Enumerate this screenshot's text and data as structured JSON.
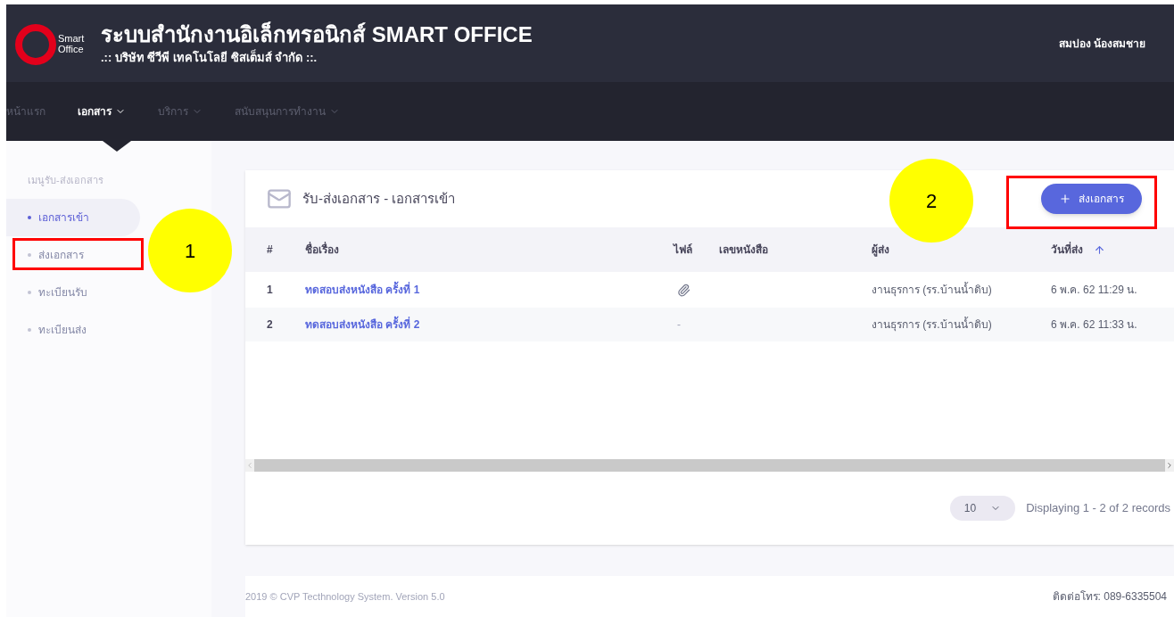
{
  "header": {
    "logo_text": [
      "Smart",
      "Office"
    ],
    "title": "ระบบสำนักงานอิเล็กทรอนิกส์ SMART OFFICE",
    "subtitle": ".:: บริษัท ซีวีพี เทคโนโลยี ซิสเต็มส์ จำกัด ::.",
    "user": "สมปอง น้องสมชาย"
  },
  "nav": [
    {
      "label": "หน้าแรก",
      "selected": false,
      "dropdown": false
    },
    {
      "label": "เอกสาร",
      "selected": true,
      "dropdown": true
    },
    {
      "label": "บริการ",
      "selected": false,
      "dropdown": true
    },
    {
      "label": "สนับสนุนการทำงาน",
      "selected": false,
      "dropdown": true
    }
  ],
  "sidebar": {
    "heading": "เมนูรับ-ส่งเอกสาร",
    "items": [
      {
        "label": "เอกสารเข้า",
        "selected": true
      },
      {
        "label": "ส่งเอกสาร",
        "selected": false
      },
      {
        "label": "ทะเบียนรับ",
        "selected": false
      },
      {
        "label": "ทะเบียนส่ง",
        "selected": false
      }
    ]
  },
  "card": {
    "title": "รับ-ส่งเอกสาร - เอกสารเข้า",
    "add_button": "ส่งเอกสาร",
    "columns": [
      "#",
      "ชื่อเรื่อง",
      "ไฟล์",
      "เลขหนังสือ",
      "ผู้ส่ง",
      "วันที่ส่ง"
    ],
    "rows": [
      {
        "no": "1",
        "subject": "ทดสอบส่งหนังสือ ครั้งที่ 1",
        "file": {
          "kind": "attachment"
        },
        "sender": "งานธุรการ (รร.บ้านน้ำดิบ)",
        "date": "6 พ.ค. 62 11:29 น."
      },
      {
        "no": "2",
        "subject": "ทดสอบส่งหนังสือ ครั้งที่ 2",
        "file": {
          "kind": "none",
          "text": "-"
        },
        "sender": "งานธุรการ (รร.บ้านน้ำดิบ)",
        "date": "6 พ.ค. 62 11:33 น."
      }
    ],
    "page_size": "10",
    "summary": "Displaying 1 - 2 of 2 records"
  },
  "footer": {
    "copyright": "2019 © CVP Tecthnology System. Version 5.0",
    "contact": "ติดต่อโทร: 089-6335504"
  },
  "annotations": [
    {
      "label": "1"
    },
    {
      "label": "2"
    }
  ]
}
